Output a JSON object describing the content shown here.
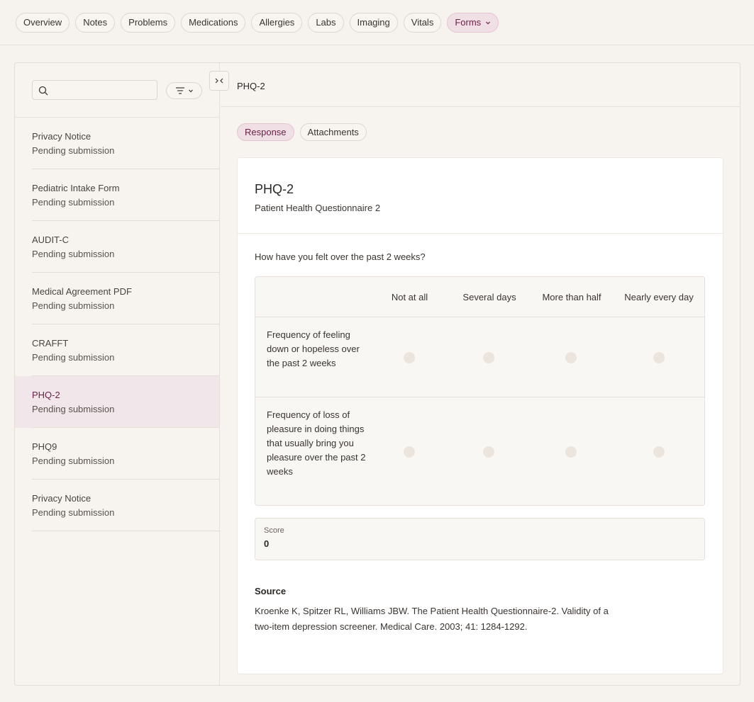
{
  "nav": {
    "tabs": [
      {
        "label": "Overview"
      },
      {
        "label": "Notes"
      },
      {
        "label": "Problems"
      },
      {
        "label": "Medications"
      },
      {
        "label": "Allergies"
      },
      {
        "label": "Labs"
      },
      {
        "label": "Imaging"
      },
      {
        "label": "Vitals"
      },
      {
        "label": "Forms",
        "active": true,
        "has_dropdown": true
      }
    ]
  },
  "sidebar": {
    "search_value": "",
    "icons": {
      "search": "search-icon",
      "filter": "filter-icon",
      "collapse": "collapse-panel-icon"
    },
    "items": [
      {
        "name": "Privacy Notice",
        "status": "Pending submission"
      },
      {
        "name": "Pediatric Intake Form",
        "status": "Pending submission"
      },
      {
        "name": "AUDIT-C",
        "status": "Pending submission"
      },
      {
        "name": "Medical Agreement PDF",
        "status": "Pending submission"
      },
      {
        "name": "CRAFFT",
        "status": "Pending submission"
      },
      {
        "name": "PHQ-2",
        "status": "Pending submission",
        "selected": true
      },
      {
        "name": "PHQ9",
        "status": "Pending submission"
      },
      {
        "name": "Privacy Notice",
        "status": "Pending submission"
      }
    ]
  },
  "main": {
    "header_title": "PHQ-2",
    "tabs": [
      {
        "label": "Response",
        "active": true
      },
      {
        "label": "Attachments"
      }
    ],
    "form": {
      "title": "PHQ-2",
      "subtitle": "Patient Health Questionnaire 2",
      "question": "How have you felt over the past 2 weeks?",
      "columns": [
        "Not at all",
        "Several days",
        "More than half",
        "Nearly every day"
      ],
      "rows": [
        {
          "label": "Frequency of feeling down or hopeless over the past 2 weeks",
          "selected": null
        },
        {
          "label": "Frequency of loss of pleasure in doing things that usually bring you pleasure over the past 2 weeks",
          "selected": null
        }
      ],
      "score_label": "Score",
      "score_value": "0",
      "source_title": "Source",
      "source_text": "Kroenke K, Spitzer RL, Williams JBW. The Patient Health Questionnaire-2. Validity of a two-item depression screener. Medical Care. 2003; 41: 1284-1292."
    }
  },
  "colors": {
    "accent": "#6b2147",
    "accent_bg": "#f1dfe6",
    "page_bg": "#f6f3ee",
    "radio_empty": "#ece5dd"
  }
}
